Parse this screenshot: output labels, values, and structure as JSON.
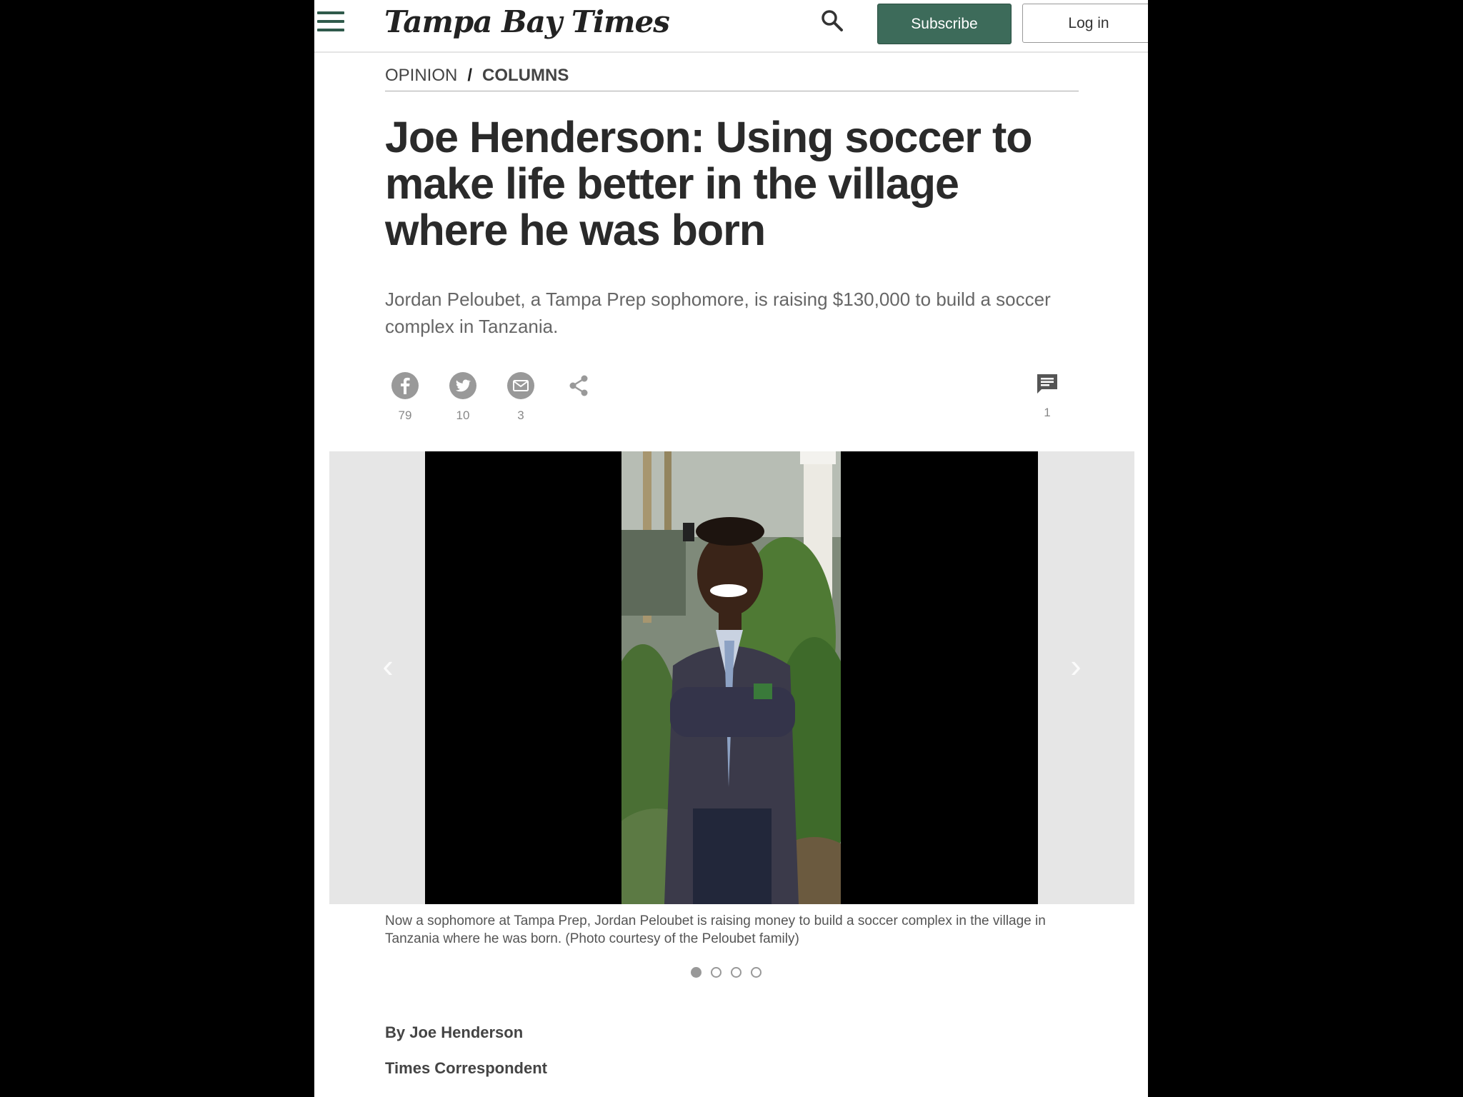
{
  "header": {
    "logo": "Tampa Bay Times",
    "subscribe_label": "Subscribe",
    "login_label": "Log in"
  },
  "breadcrumb": {
    "section": "OPINION",
    "separator": "/",
    "subsection": "COLUMNS"
  },
  "article": {
    "headline": "Joe Henderson: Using soccer to make life better in the village where he was born",
    "dek": "Jordan Peloubet, a Tampa Prep sophomore, is raising $130,000 to build a soccer complex in Tanzania.",
    "byline": "By Joe Henderson",
    "role": "Times Correspondent"
  },
  "share": {
    "facebook_count": "79",
    "twitter_count": "10",
    "email_count": "3",
    "comments_count": "1"
  },
  "gallery": {
    "caption": "Now a sophomore at Tampa Prep, Jordan Peloubet is raising money to build a soccer complex in the village in Tanzania where he was born. (Photo courtesy of the Peloubet family)",
    "total_slides": 4,
    "active_slide": 1
  },
  "colors": {
    "accent": "#3d6b5a",
    "text": "#2a2a2a"
  }
}
